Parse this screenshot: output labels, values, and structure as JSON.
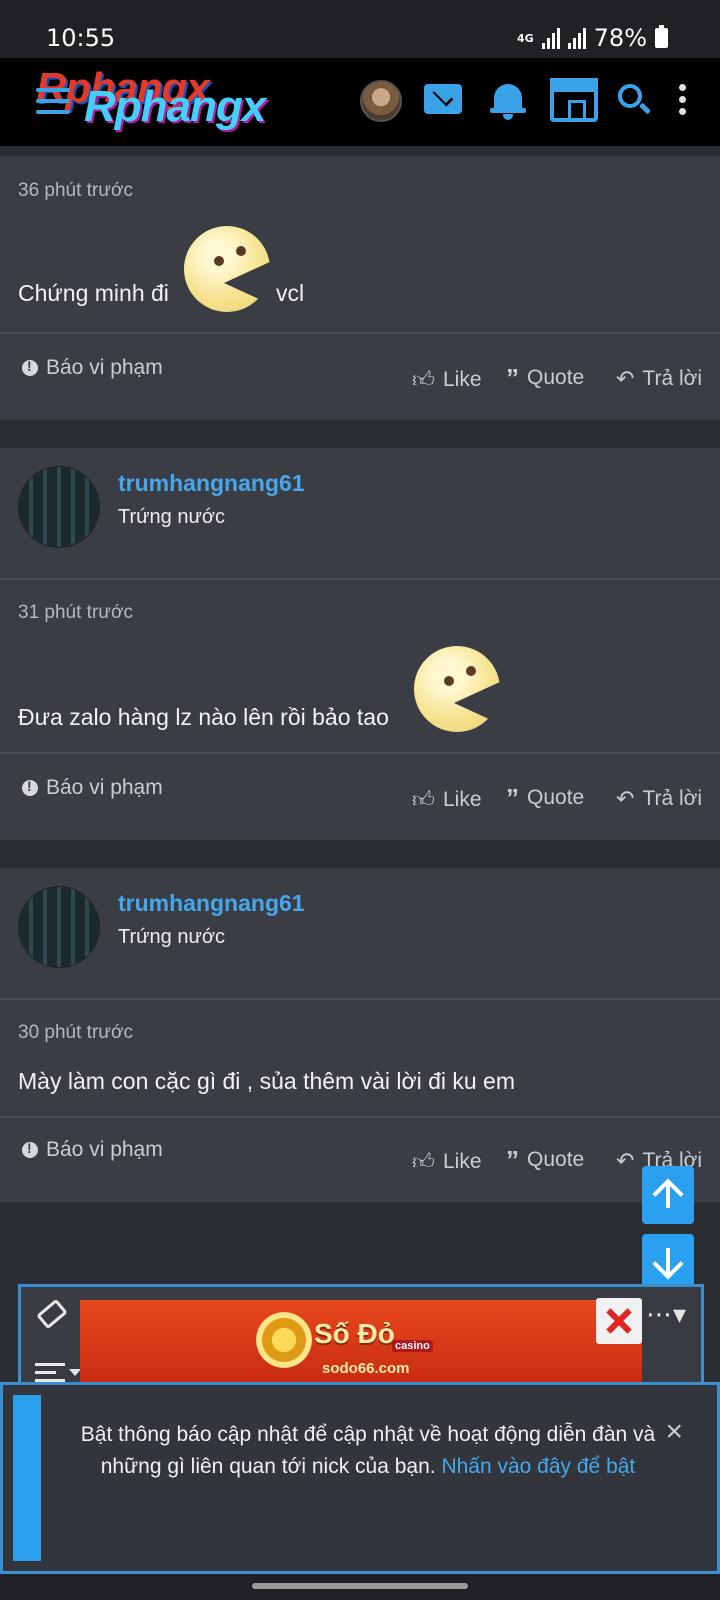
{
  "status_bar": {
    "time": "10:55",
    "network": "4G",
    "battery": "78%"
  },
  "header": {
    "logo_text_back": "Rphang",
    "logo_text_front": "Rphang",
    "logo_suffix": "x",
    "icons": [
      "menu-icon",
      "avatar",
      "mail-icon",
      "bell-icon",
      "store-icon",
      "search-icon",
      "more-vertical-icon"
    ],
    "accent_color": "#3aa3e8"
  },
  "posts": [
    {
      "time": "36 phút trước",
      "text": "Chứng minh đi",
      "text_after": "vcl",
      "has_emoji": true
    },
    {
      "user": "trumhangnang61",
      "user_title": "Trứng nước",
      "time": "31 phút trước",
      "text": "Đưa zalo hàng lz nào lên rồi bảo tao",
      "has_emoji": true
    },
    {
      "user": "trumhangnang61",
      "user_title": "Trứng nước",
      "time": "30 phút trước",
      "text": "Mày làm con cặc gì đi , sủa thêm vài lời đi ku em",
      "has_emoji": false
    }
  ],
  "actions": {
    "report": "Báo vi phạm",
    "like": "Like",
    "quote": "Quote",
    "reply": "Trả lời"
  },
  "ad": {
    "brand": "Số Đỏ",
    "tag": "casino",
    "url": "sodo66.com"
  },
  "notification": {
    "text": "Bật thông báo cập nhật để cập nhật về hoạt động diễn đàn và những gì liên quan tới nick của bạn.",
    "link": "Nhấn vào đây để bật",
    "close": "×"
  }
}
